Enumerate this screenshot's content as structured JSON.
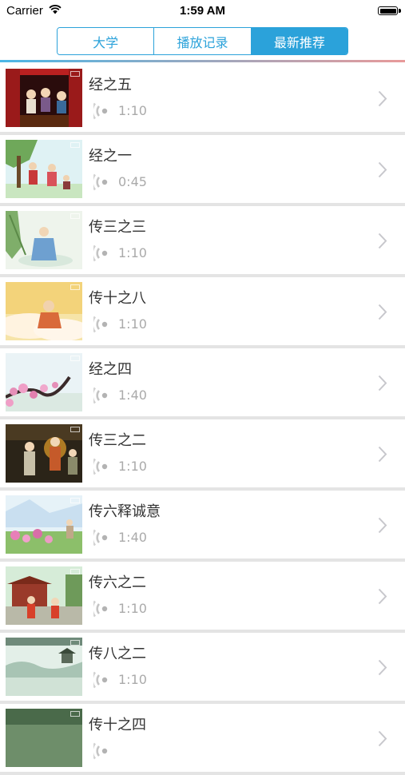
{
  "status_bar": {
    "carrier": "Carrier",
    "time": "1:59 AM"
  },
  "segmented": {
    "tabs": [
      {
        "label": "大学",
        "selected": false
      },
      {
        "label": "播放记录",
        "selected": false
      },
      {
        "label": "最新推荐",
        "selected": true
      }
    ]
  },
  "colors": {
    "accent": "#2ba2da",
    "divider": "#e4e4e4",
    "duration_text": "#aaaaaa"
  },
  "list": {
    "items": [
      {
        "title": "经之五",
        "duration": "1:10",
        "scene": "stage-red-curtains"
      },
      {
        "title": "经之一",
        "duration": "0:45",
        "scene": "tree-scholars"
      },
      {
        "title": "传三之三",
        "duration": "1:10",
        "scene": "willow-scholar"
      },
      {
        "title": "传十之八",
        "duration": "1:10",
        "scene": "golden-cloud-figure"
      },
      {
        "title": "经之四",
        "duration": "1:40",
        "scene": "plum-blossom-branch"
      },
      {
        "title": "传三之二",
        "duration": "1:10",
        "scene": "dark-hall-figures"
      },
      {
        "title": "传六释诚意",
        "duration": "1:40",
        "scene": "garden-flowers"
      },
      {
        "title": "传六之二",
        "duration": "1:10",
        "scene": "pavilion-courtyard"
      },
      {
        "title": "传八之二",
        "duration": "1:10",
        "scene": "misty-landscape"
      },
      {
        "title": "传十之四",
        "duration": "",
        "scene": "partial-thumbnail"
      }
    ]
  }
}
